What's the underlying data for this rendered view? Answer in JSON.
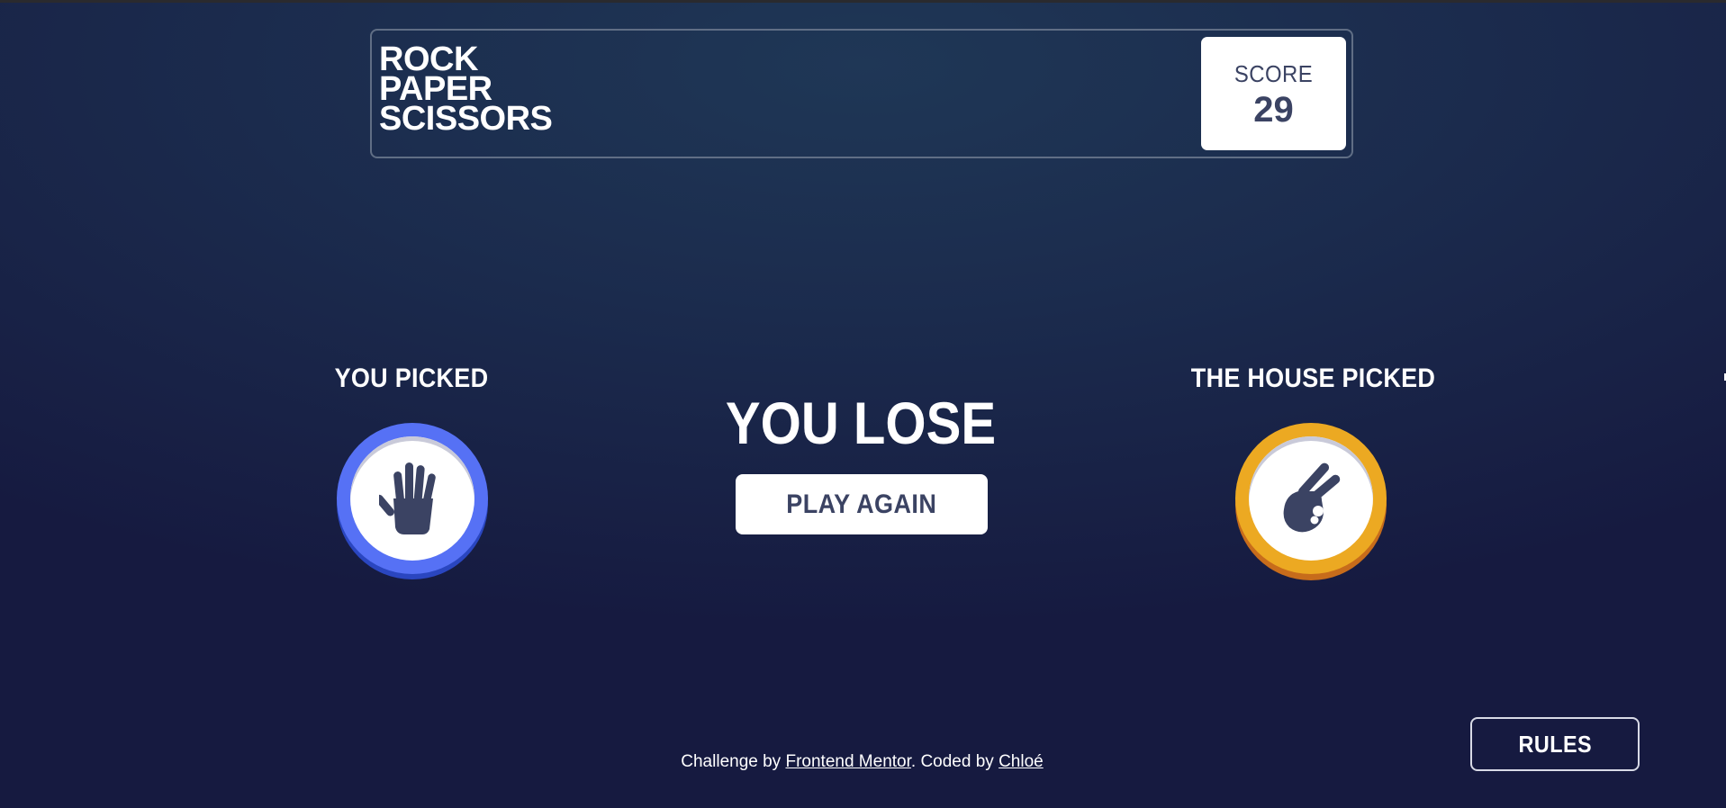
{
  "header": {
    "logo_lines": [
      "ROCK",
      "PAPER",
      "SCISSORS"
    ],
    "score_label": "SCORE",
    "score_value": "29"
  },
  "game": {
    "you_picked_label": "YOU PICKED",
    "house_picked_label": "THE HOUSE PICKED",
    "player_choice": "paper",
    "house_choice": "scissors",
    "result_text": "YOU LOSE",
    "play_again_label": "PLAY AGAIN"
  },
  "rules_button": {
    "label": "RULES"
  },
  "footer": {
    "prefix": "Challenge by ",
    "challenge_link": "Frontend Mentor",
    "middle": ". Coded by ",
    "author_link": "Chloé"
  },
  "colors": {
    "paper": "#5671f5",
    "scissors": "#eca922",
    "dark_text": "#3b4363",
    "header_outline": "#606e85"
  },
  "icons": {
    "player": "paper-hand-icon",
    "house": "scissors-hand-icon"
  }
}
